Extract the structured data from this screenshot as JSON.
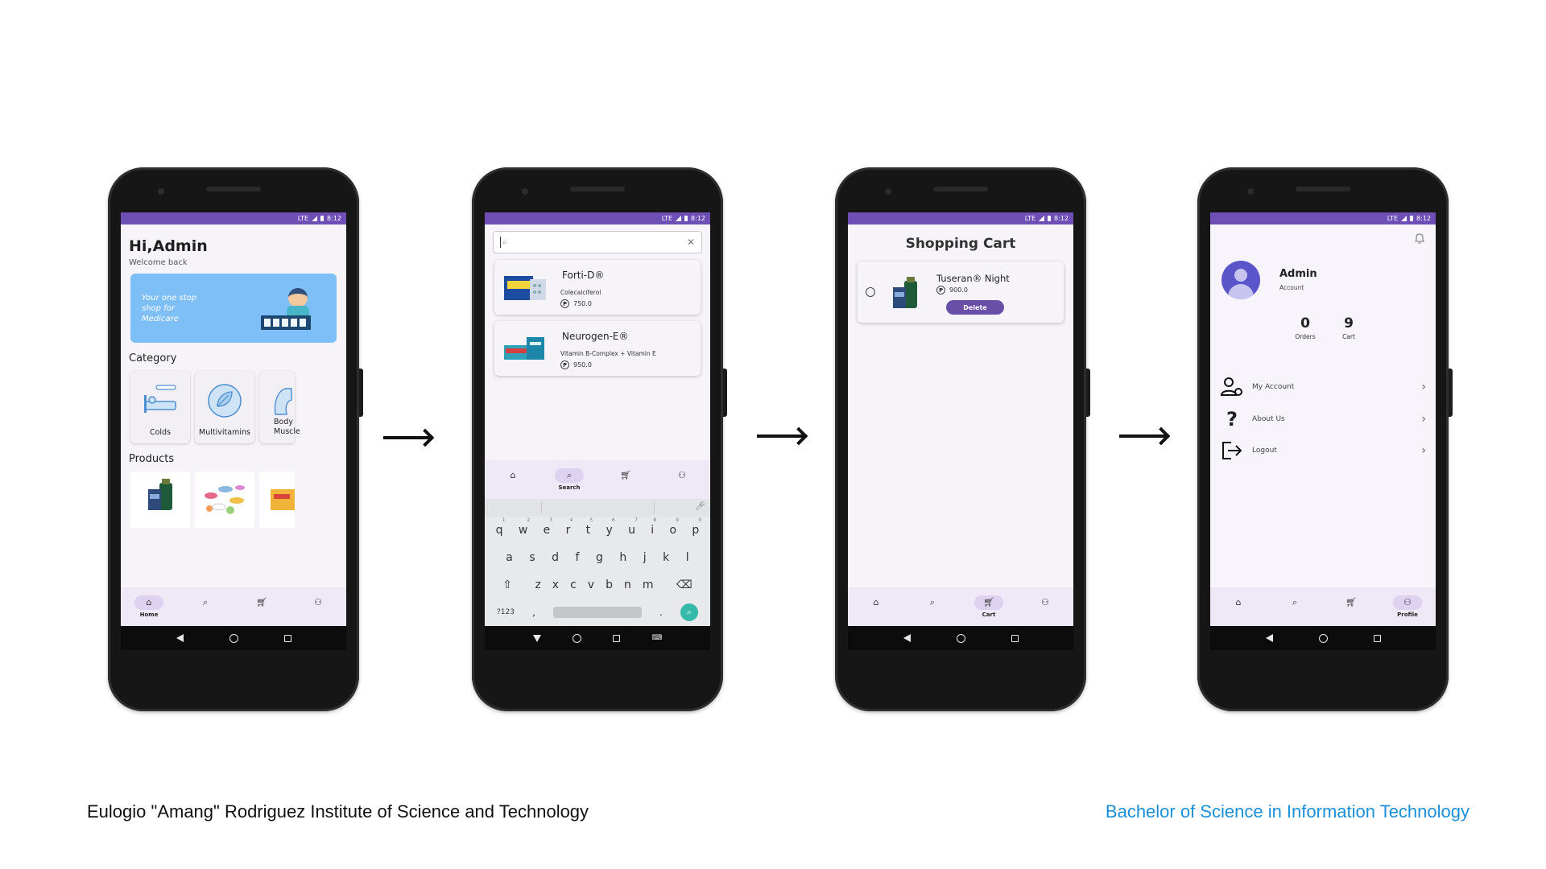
{
  "status": {
    "time": "8:12",
    "network": "LTE"
  },
  "tabs": [
    {
      "key": "home",
      "label": "Home",
      "icon": "home-icon"
    },
    {
      "key": "search",
      "label": "Search",
      "icon": "search-icon"
    },
    {
      "key": "cart",
      "label": "Cart",
      "icon": "cart-icon"
    },
    {
      "key": "profile",
      "label": "Profile",
      "icon": "profile-icon"
    }
  ],
  "home": {
    "greeting": "Hi,Admin",
    "welcome": "Welcome back",
    "banner_text": "Your one stop shop for Medicare",
    "category_heading": "Category",
    "categories": [
      "Colds",
      "Multivitamins",
      "Body Muscle"
    ],
    "products_heading": "Products"
  },
  "search": {
    "query": "",
    "results": [
      {
        "name": "Forti-D®",
        "desc": "Colecalciferol",
        "price": "750.0"
      },
      {
        "name": "Neurogen-E®",
        "desc": "Vitamin B-Complex + Vitamin E",
        "price": "950.0"
      }
    ],
    "keyboard": {
      "row1": [
        "q",
        "w",
        "e",
        "r",
        "t",
        "y",
        "u",
        "i",
        "o",
        "p"
      ],
      "row1_nums": [
        "1",
        "2",
        "3",
        "4",
        "5",
        "6",
        "7",
        "8",
        "9",
        "0"
      ],
      "row2": [
        "a",
        "s",
        "d",
        "f",
        "g",
        "h",
        "j",
        "k",
        "l"
      ],
      "row3": [
        "z",
        "x",
        "c",
        "v",
        "b",
        "n",
        "m"
      ],
      "sym_key": "?123",
      "comma": ",",
      "period": "."
    }
  },
  "cart": {
    "title": "Shopping Cart",
    "items": [
      {
        "name": "Tuseran® Night",
        "price": "900.0",
        "delete_label": "Delete"
      }
    ]
  },
  "profile": {
    "name": "Admin",
    "role": "Account",
    "stats": [
      {
        "value": "0",
        "label": "Orders"
      },
      {
        "value": "9",
        "label": "Cart"
      }
    ],
    "menu": [
      {
        "label": "My Account",
        "icon": "account-settings-icon"
      },
      {
        "label": "About Us",
        "icon": "question-icon"
      },
      {
        "label": "Logout",
        "icon": "logout-icon"
      }
    ]
  },
  "footer": {
    "institution": "Eulogio \"Amang\" Rodriguez Institute of Science and Technology",
    "program": "Bachelor of Science in Information Technology"
  },
  "colors": {
    "status_bar": "#6e4fb6",
    "tab_bar": "#efe8f6",
    "accent": "#6a4fa8",
    "banner": "#7fbff7",
    "program_text": "#1a90d8"
  }
}
